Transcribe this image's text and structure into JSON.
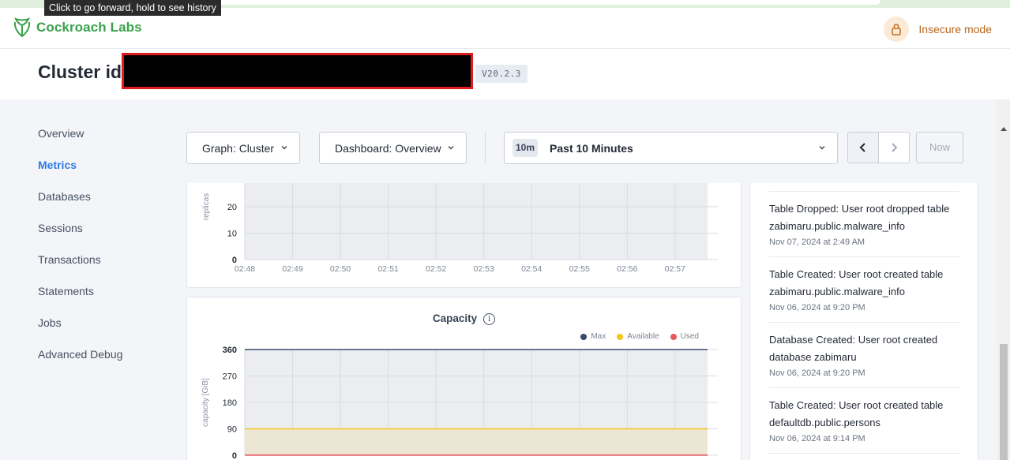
{
  "browser": {
    "tooltip": "Click to go forward, hold to see history"
  },
  "header": {
    "logo_text": "Cockroach Labs",
    "insecure_label": "Insecure mode"
  },
  "cluster": {
    "label": "Cluster id:",
    "version": "V20.2.3"
  },
  "sidebar": {
    "items": [
      {
        "label": "Overview",
        "active": false
      },
      {
        "label": "Metrics",
        "active": true
      },
      {
        "label": "Databases",
        "active": false
      },
      {
        "label": "Sessions",
        "active": false
      },
      {
        "label": "Transactions",
        "active": false
      },
      {
        "label": "Statements",
        "active": false
      },
      {
        "label": "Jobs",
        "active": false
      },
      {
        "label": "Advanced Debug",
        "active": false
      }
    ]
  },
  "filters": {
    "graph": "Graph: Cluster",
    "dashboard": "Dashboard: Overview",
    "time_badge": "10m",
    "time_range": "Past 10 Minutes",
    "now_label": "Now"
  },
  "colors": {
    "accent": "#2f7ae5",
    "brand": "#3aa24b",
    "max": "#3a4a6b",
    "available": "#f5c518",
    "used": "#e5585e"
  },
  "chart_data": [
    {
      "type": "line",
      "title": "",
      "ylabel": "replicas",
      "x": [
        "02:48",
        "02:49",
        "02:50",
        "02:51",
        "02:52",
        "02:53",
        "02:54",
        "02:55",
        "02:56",
        "02:57"
      ],
      "yticks": [
        "0",
        "10",
        "20"
      ],
      "series": []
    },
    {
      "type": "area",
      "title": "Capacity",
      "ylabel": "capacity [GiB]",
      "yticks": [
        "0",
        "90",
        "180",
        "270",
        "360"
      ],
      "ylim": [
        0,
        360
      ],
      "grid": true,
      "legend_position": "top-right",
      "series": [
        {
          "name": "Max",
          "color": "#3a4a6b",
          "value": 360
        },
        {
          "name": "Available",
          "color": "#f5c518",
          "value": 90
        },
        {
          "name": "Used",
          "color": "#e5585e",
          "value": 0.5
        }
      ]
    }
  ],
  "events": [
    {
      "title": "Table Dropped: User root dropped table zabimaru.public.malware_info",
      "time": "Nov 07, 2024 at 2:49 AM"
    },
    {
      "title": "Table Created: User root created table zabimaru.public.malware_info",
      "time": "Nov 06, 2024 at 9:20 PM"
    },
    {
      "title": "Database Created: User root created database zabimaru",
      "time": "Nov 06, 2024 at 9:20 PM"
    },
    {
      "title": "Table Created: User root created table defaultdb.public.persons",
      "time": "Nov 06, 2024 at 9:14 PM"
    }
  ]
}
